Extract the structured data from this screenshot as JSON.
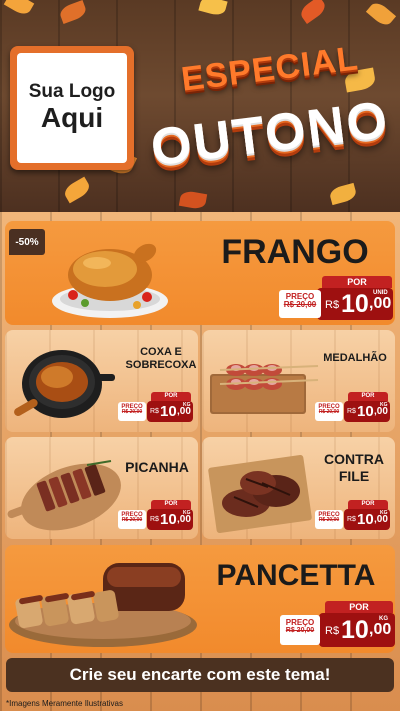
{
  "logo": {
    "line1": "Sua Logo",
    "line2": "Aqui"
  },
  "title": {
    "line1": "ESPECIAL",
    "line2": "OUTONO"
  },
  "colors": {
    "orange": "#f28a2c",
    "red_tag": "#c22121",
    "dark_red": "#9e1010",
    "brown": "#4b3120"
  },
  "products": [
    {
      "name": "FRANGO",
      "discount": "-50%",
      "por": "POR",
      "preco": "PREÇO",
      "old_price": "R$ 20,00",
      "currency": "R$",
      "price_int": "10",
      "price_cents": ",00",
      "unit": "UNID"
    },
    {
      "name_line1": "COXA E",
      "name_line2": "SOBRECOXA",
      "por": "POR",
      "preco": "PREÇO",
      "old_price": "R$ 20,00",
      "currency": "R$",
      "price_int": "10",
      "price_cents": ",00",
      "unit": "KG"
    },
    {
      "name": "MEDALHÃO",
      "por": "POR",
      "preco": "PREÇO",
      "old_price": "R$ 20,00",
      "currency": "R$",
      "price_int": "10",
      "price_cents": ",00",
      "unit": "KG"
    },
    {
      "name": "PICANHA",
      "por": "POR",
      "preco": "PREÇO",
      "old_price": "R$ 20,00",
      "currency": "R$",
      "price_int": "10",
      "price_cents": ",00",
      "unit": "KG"
    },
    {
      "name_line1": "CONTRA",
      "name_line2": "FILE",
      "por": "POR",
      "preco": "PREÇO",
      "old_price": "R$ 20,00",
      "currency": "R$",
      "price_int": "10",
      "price_cents": ",00",
      "unit": "KG"
    },
    {
      "name": "PANCETTA",
      "por": "POR",
      "preco": "PREÇO",
      "old_price": "R$ 20,00",
      "currency": "R$",
      "price_int": "10",
      "price_cents": ",00",
      "unit": "KG"
    }
  ],
  "banner": "Crie seu encarte com este tema!",
  "disclaimer": "*Imagens Meramente Ilustrativas"
}
